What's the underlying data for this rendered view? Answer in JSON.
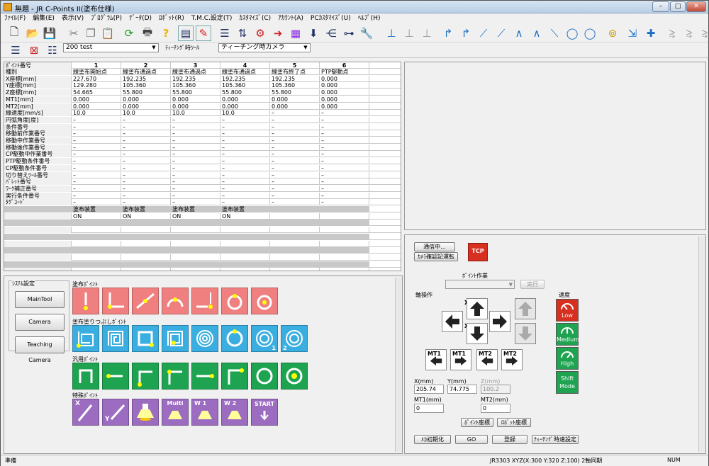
{
  "window": {
    "title": "無題 - JR C-Points II(塗布仕様)",
    "min": "–",
    "max": "□",
    "close": "✕"
  },
  "menu": [
    "ﾌｧｲﾙ(F)",
    "編集(E)",
    "表示(V)",
    "ﾌﾟﾛｸﾞﾗﾑ(P)",
    "ﾃﾞｰﾀ(D)",
    "ﾛﾎﾞｯﾄ(R)",
    "T.M.C.設定(T)",
    "ｶｽﾀﾏｲｽﾞ(C)",
    "ｱｶｳﾝﾄ(A)",
    "PCｶｽﾀﾏｲｽﾞ(U)",
    "ﾍﾙﾌﾟ(H)"
  ],
  "toolbar2": {
    "program_select": "200    test",
    "tool_label": "ﾃｨｰﾁﾝｸﾞ時ﾂｰﾙ",
    "tool_select": "ティーチング時カメラ"
  },
  "grid": {
    "header_label": "ﾎﾟｲﾝﾄ番号",
    "columns": [
      "1",
      "2",
      "3",
      "4",
      "5",
      "6"
    ],
    "rows": [
      {
        "label": "種別",
        "v": [
          "線塗布開始点",
          "線塗布通過点",
          "線塗布通過点",
          "線塗布通過点",
          "線塗布終了点",
          "PTP駆動点"
        ]
      },
      {
        "label": "X座標[mm]",
        "v": [
          "227.670",
          "192.235",
          "192.235",
          "192.235",
          "192.235",
          "0.000"
        ]
      },
      {
        "label": "Y座標[mm]",
        "v": [
          "129.280",
          "105.360",
          "105.360",
          "105.360",
          "105.360",
          "0.000"
        ]
      },
      {
        "label": "Z座標[mm]",
        "v": [
          "54.665",
          "55.800",
          "55.800",
          "55.800",
          "55.800",
          "0.000"
        ]
      },
      {
        "label": "MT1[mm]",
        "v": [
          "0.000",
          "0.000",
          "0.000",
          "0.000",
          "0.000",
          "0.000"
        ]
      },
      {
        "label": "MT2[mm]",
        "v": [
          "0.000",
          "0.000",
          "0.000",
          "0.000",
          "0.000",
          "0.000"
        ]
      },
      {
        "label": "線速度[mm/s]",
        "v": [
          "10.0",
          "10.0",
          "10.0",
          "10.0",
          "–",
          "–"
        ]
      },
      {
        "label": "円弧角度[度]",
        "v": [
          "–",
          "–",
          "–",
          "–",
          "–",
          "–"
        ]
      },
      {
        "label": "条件番号",
        "v": [
          "–",
          "–",
          "–",
          "–",
          "–",
          "–"
        ]
      },
      {
        "label": "移動前作業番号",
        "v": [
          "–",
          "–",
          "–",
          "–",
          "–",
          "–"
        ]
      },
      {
        "label": "移動中作業番号",
        "v": [
          "–",
          "–",
          "–",
          "–",
          "–",
          "–"
        ]
      },
      {
        "label": "移動後作業番号",
        "v": [
          "–",
          "–",
          "–",
          "–",
          "–",
          "–"
        ]
      },
      {
        "label": "CP駆動中作業番号",
        "v": [
          "–",
          "–",
          "–",
          "–",
          "–",
          "–"
        ]
      },
      {
        "label": "PTP駆動条件番号",
        "v": [
          "–",
          "–",
          "–",
          "–",
          "–",
          "–"
        ]
      },
      {
        "label": "CP駆動条件番号",
        "v": [
          "–",
          "–",
          "–",
          "–",
          "–",
          "–"
        ]
      },
      {
        "label": "切り替えﾂｰﾙ番号",
        "v": [
          "–",
          "–",
          "–",
          "–",
          "–",
          "–"
        ]
      },
      {
        "label": "ﾊﾟﾚｯﾄ番号",
        "v": [
          "–",
          "–",
          "–",
          "–",
          "–",
          "–"
        ]
      },
      {
        "label": "ﾜｰｸ補正番号",
        "v": [
          "–",
          "–",
          "–",
          "–",
          "–",
          "–"
        ]
      },
      {
        "label": "実行条件番号",
        "v": [
          "–",
          "–",
          "–",
          "–",
          "–",
          "–"
        ]
      },
      {
        "label": "ﾀｸﾞｺｰﾄﾞ",
        "v": [
          "–",
          "–",
          "–",
          "–",
          "–",
          "–"
        ]
      }
    ],
    "extra": {
      "v1": [
        "塗布装置",
        "塗布装置",
        "塗布装置",
        "塗布装置",
        "",
        ""
      ],
      "v2": [
        "ON",
        "ON",
        "ON",
        "ON",
        "",
        ""
      ]
    }
  },
  "left_panel": {
    "system_label": "ｼｽﾃﾑ設定",
    "buttons": [
      "MainTool",
      "Camera",
      "Teaching Camera"
    ],
    "groups": [
      {
        "label": "塗布ﾎﾟｲﾝﾄ",
        "color": "red",
        "count": 7
      },
      {
        "label": "塗布塗りつぶしﾎﾟｲﾝﾄ",
        "color": "blue",
        "count": 7
      },
      {
        "label": "汎用ﾎﾟｲﾝﾄ",
        "color": "green",
        "count": 7
      },
      {
        "label": "特殊ﾎﾟｲﾝﾄ",
        "color": "purple",
        "count": 7
      }
    ],
    "icon_texts": {
      "x": "X",
      "y": "Y",
      "multi": "Multi",
      "w1": "W 1",
      "w2": "W 2",
      "start": "START",
      "s1": "1",
      "s2": "2"
    }
  },
  "right_panel": {
    "btn_comm": "通信中...",
    "btn_camera": "ｶﾒﾗ確認記運転",
    "tcp": "TCP",
    "point_work_label": "ﾎﾟｲﾝﾄ作業",
    "exec": "実行",
    "axis_label": "軸操作",
    "speed_label": "速度",
    "axes": {
      "x": "X",
      "y": "Y",
      "z": "Z",
      "mt1": "MT1",
      "mt2": "MT2"
    },
    "speeds": [
      "Low",
      "Medium",
      "High",
      "Shift Mode"
    ],
    "x_label": "X(mm)",
    "x_val": "205.74",
    "y_label": "Y(mm)",
    "y_val": "74.775",
    "z_label": "Z(mm)",
    "z_val": "100.2",
    "mt1_label": "MT1(mm)",
    "mt1_val": "0",
    "mt2_label": "MT2(mm)",
    "mt2_val": "0",
    "btn_point_coord": "ﾎﾟｲﾝﾄ座標",
    "btn_robot_coord": "ﾛﾎﾞｯﾄ座標",
    "btn_mecha": "ﾒｶ初期化",
    "btn_go": "GO",
    "btn_register": "登録",
    "btn_teach_speed": "ﾃｨｰﾁﾝｸﾞ時速設定"
  },
  "status": {
    "left": "準備",
    "robot": "JR3303 XYZ(X:300 Y:320 Z:100) 2軸同期",
    "num": "NUM"
  }
}
